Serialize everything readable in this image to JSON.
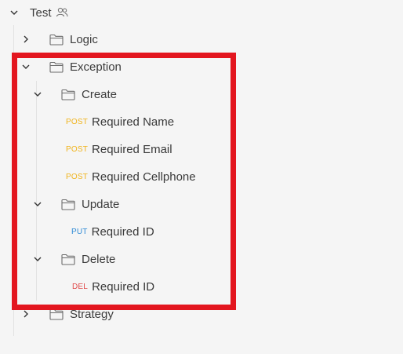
{
  "colors": {
    "post": "#f0b41d",
    "put": "#2f8bd6",
    "del": "#e04b4b",
    "highlight": "#e3161f"
  },
  "tree": {
    "root": {
      "label": "Test",
      "expanded": true,
      "icon": "users-icon"
    },
    "logic": {
      "label": "Logic",
      "expanded": false,
      "icon": "folder-icon"
    },
    "exception": {
      "label": "Exception",
      "expanded": true,
      "icon": "folder-icon"
    },
    "create": {
      "label": "Create",
      "expanded": true,
      "icon": "folder-icon"
    },
    "required_name": {
      "method": "POST",
      "label": "Required Name"
    },
    "required_email": {
      "method": "POST",
      "label": "Required Email"
    },
    "required_cellphone": {
      "method": "POST",
      "label": "Required Cellphone"
    },
    "update": {
      "label": "Update",
      "expanded": true,
      "icon": "folder-icon"
    },
    "update_required_id": {
      "method": "PUT",
      "label": "Required ID"
    },
    "delete": {
      "label": "Delete",
      "expanded": true,
      "icon": "folder-icon"
    },
    "delete_required_id": {
      "method": "DEL",
      "label": "Required ID"
    },
    "strategy": {
      "label": "Strategy",
      "expanded": false,
      "icon": "folder-icon"
    }
  }
}
